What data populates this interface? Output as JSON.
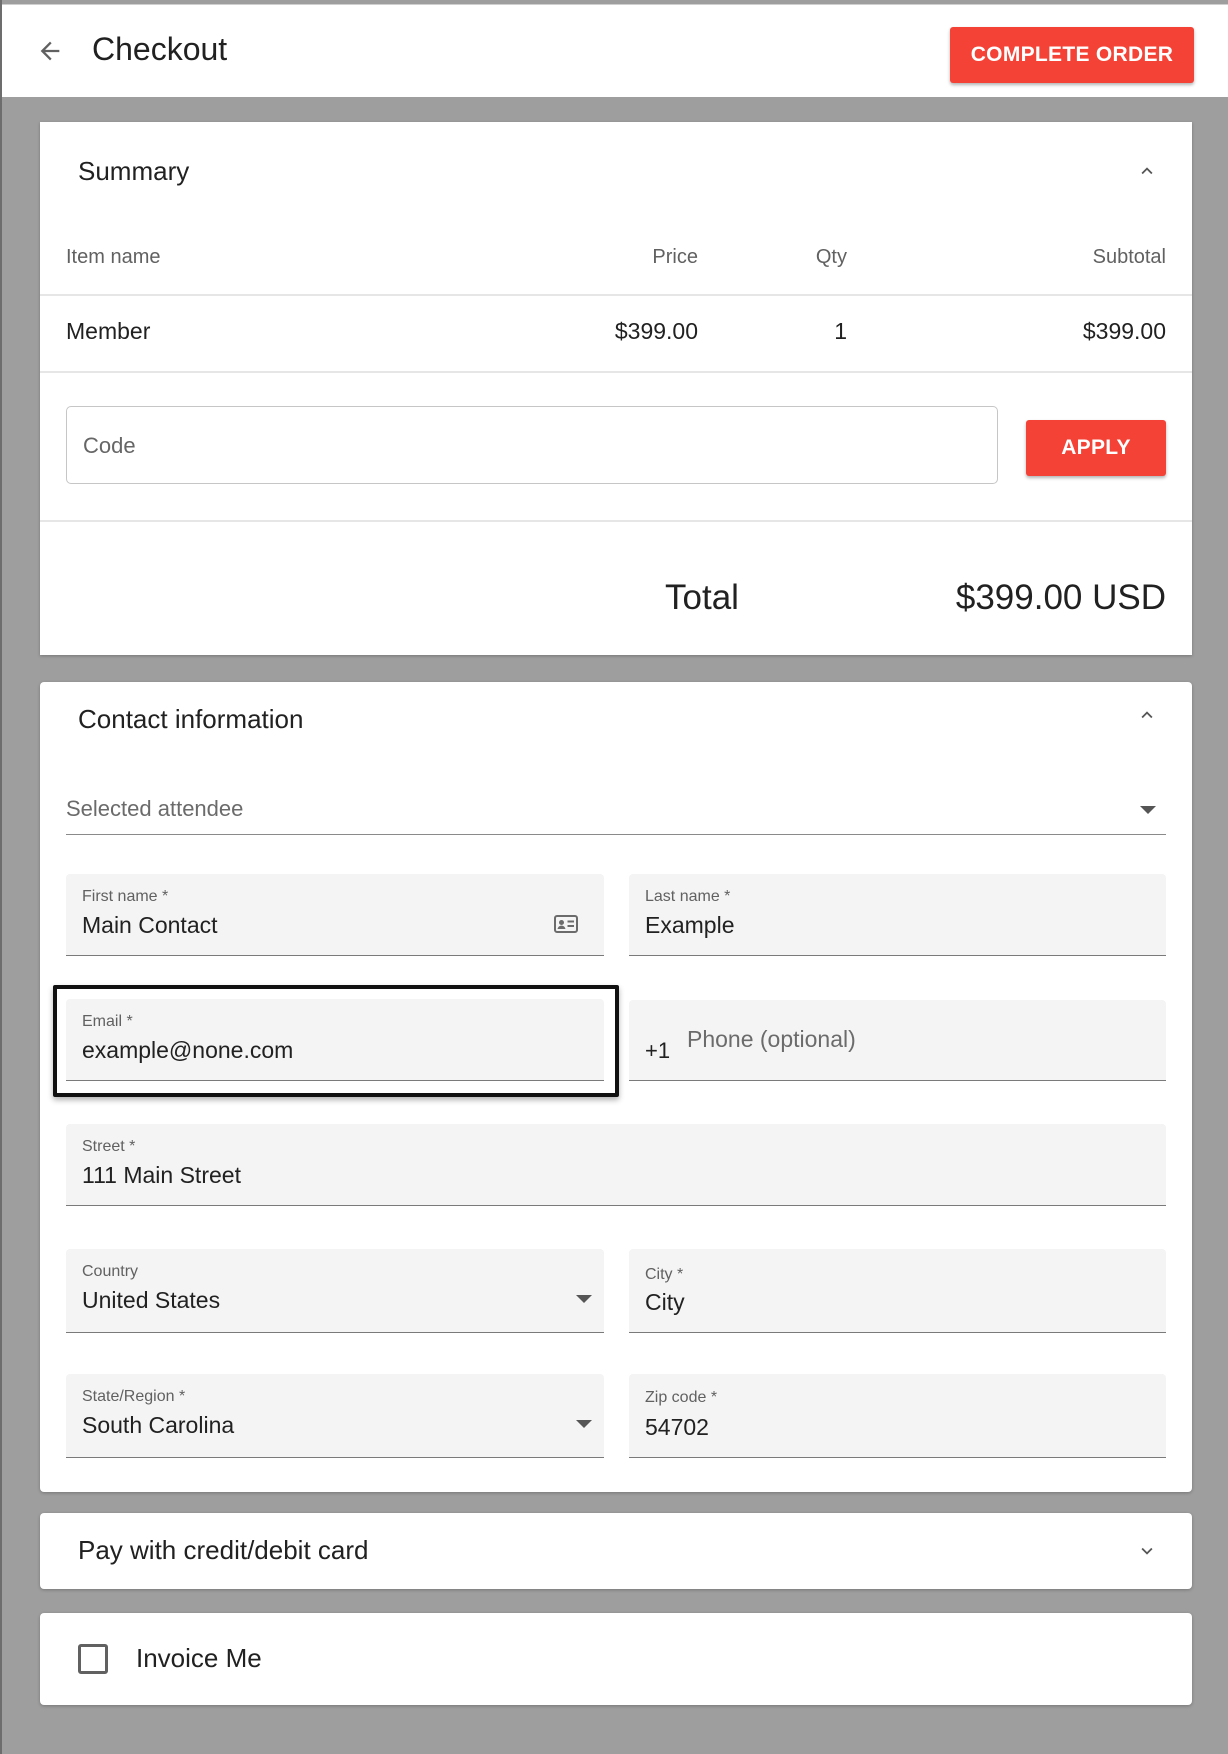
{
  "header": {
    "title": "Checkout",
    "complete_label": "COMPLETE ORDER",
    "back_icon": "arrow-left-icon"
  },
  "summary": {
    "title": "Summary",
    "columns": [
      "Item name",
      "Price",
      "Qty",
      "Subtotal"
    ],
    "rows": [
      {
        "name": "Member",
        "price": "$399.00",
        "qty": "1",
        "subtotal": "$399.00"
      }
    ],
    "code_placeholder": "Code",
    "apply_label": "APPLY",
    "total_label": "Total",
    "total_value": "$399.00 USD"
  },
  "contact": {
    "title": "Contact information",
    "attendee_label": "Selected attendee",
    "first_name": {
      "label": "First name *",
      "value": "Main Contact"
    },
    "last_name": {
      "label": "Last name *",
      "value": "Example"
    },
    "email": {
      "label": "Email *",
      "value": "example@none.com"
    },
    "phone": {
      "prefix": "+1",
      "placeholder": "Phone (optional)"
    },
    "street": {
      "label": "Street *",
      "value": "111 Main Street"
    },
    "country": {
      "label": "Country",
      "value": "United States"
    },
    "city": {
      "label": "City *",
      "value": "City"
    },
    "state": {
      "label": "State/Region *",
      "value": "South Carolina"
    },
    "zip": {
      "label": "Zip code *",
      "value": "54702"
    }
  },
  "payment": {
    "title": "Pay with credit/debit card"
  },
  "invoice": {
    "label": "Invoice Me",
    "checked": false
  },
  "colors": {
    "accent": "#f44336",
    "background": "#9e9e9e",
    "highlight": "#111111"
  }
}
